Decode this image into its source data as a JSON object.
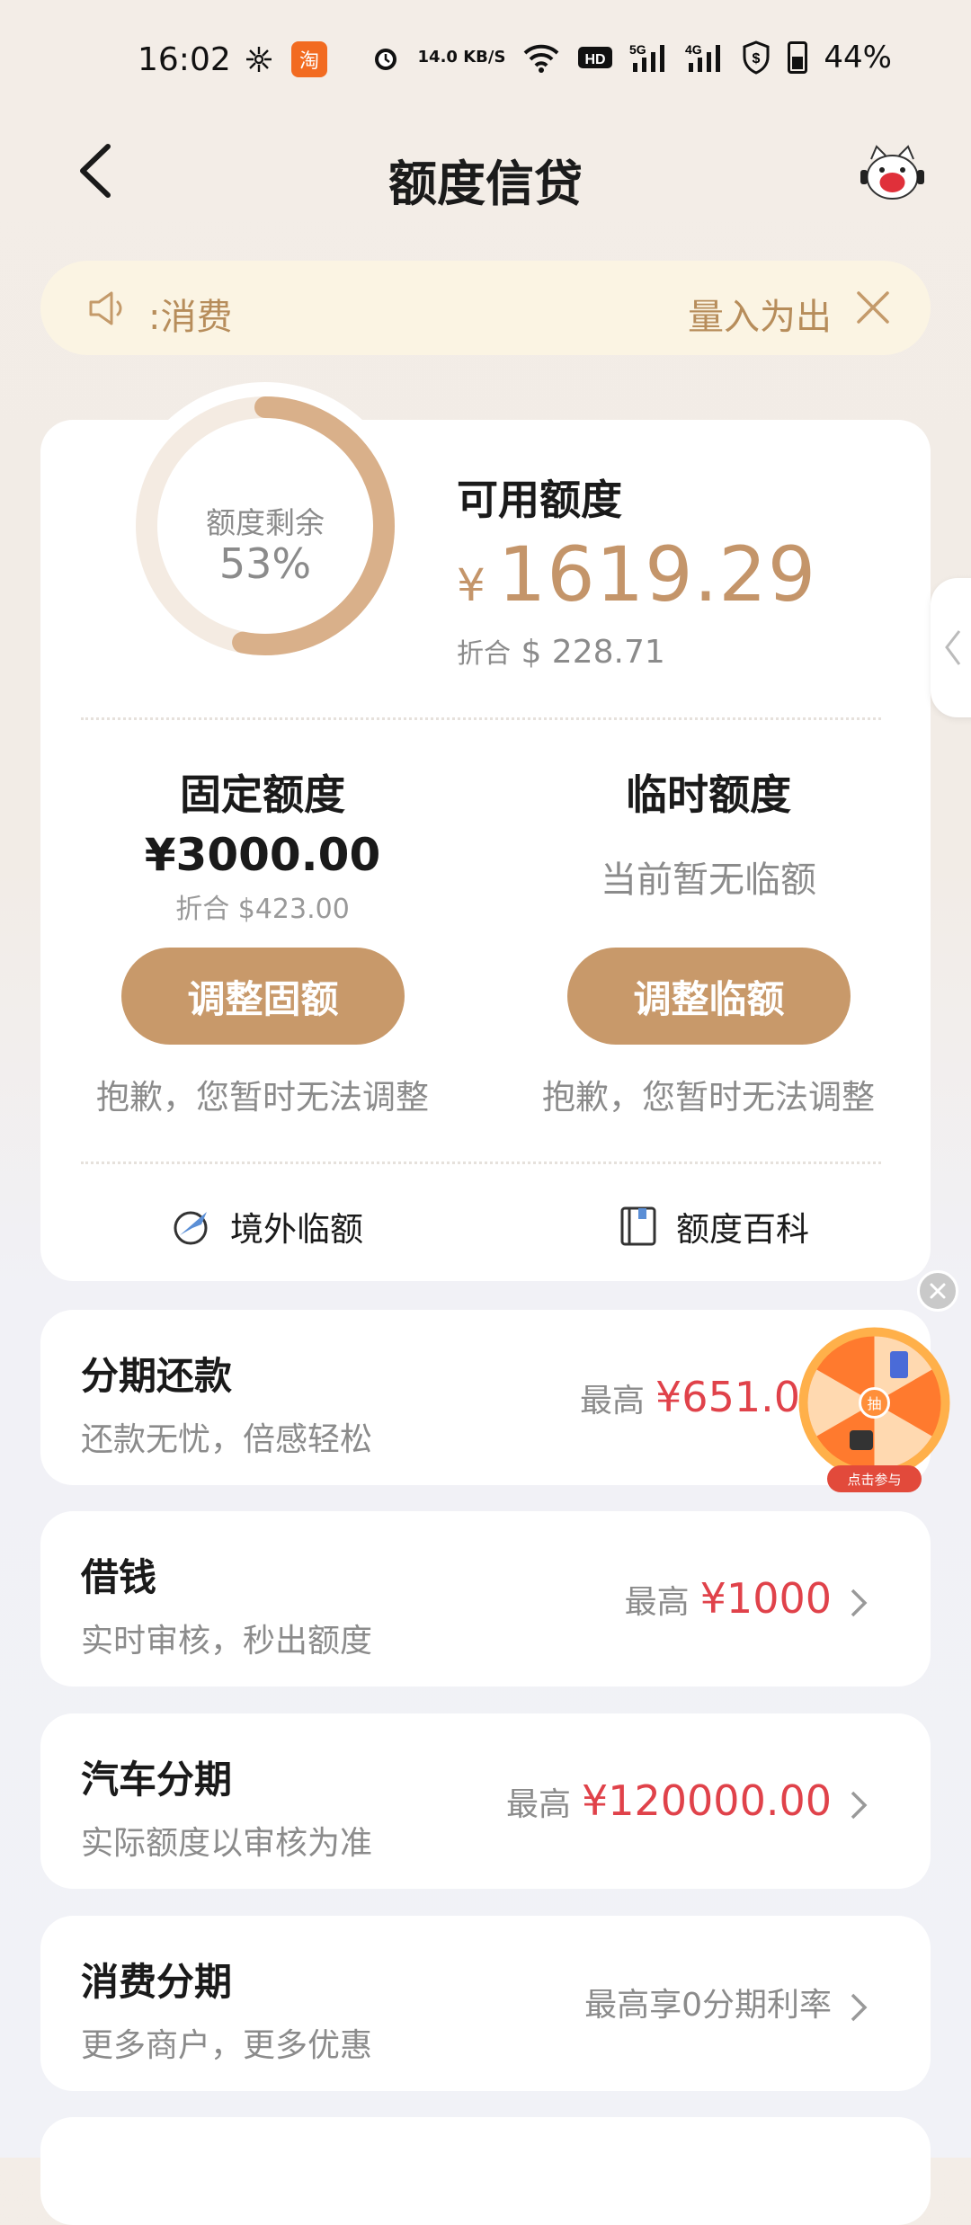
{
  "status_bar": {
    "time": "16:02",
    "net_speed": "14.0 KB/S",
    "battery": "44%"
  },
  "header": {
    "title": "额度信贷"
  },
  "notice": {
    "text": ":消费",
    "right_text": "量入为出"
  },
  "credit": {
    "ring_label": "额度剩余",
    "ring_percent": "53%",
    "ring_fraction": 0.53,
    "available_label": "可用额度",
    "available_currency": "¥",
    "available_amount": "1619.29",
    "available_conv_prefix": "折合",
    "available_conv_value": "$ 228.71"
  },
  "fixed": {
    "title": "固定额度",
    "amount": "¥3000.00",
    "conv": "折合 $423.00",
    "button": "调整固额",
    "note": "抱歉，您暂时无法调整"
  },
  "temp": {
    "title": "临时额度",
    "none_text": "当前暂无临额",
    "button": "调整临额",
    "note": "抱歉，您暂时无法调整"
  },
  "links": {
    "overseas": "境外临额",
    "wiki": "额度百科"
  },
  "services": [
    {
      "title": "分期还款",
      "sub": "还款无忧，倍感轻松",
      "pre": "最高",
      "value": "¥651.0"
    },
    {
      "title": "借钱",
      "sub": "实时审核，秒出额度",
      "pre": "最高",
      "value": "¥1000"
    },
    {
      "title": "汽车分期",
      "sub": "实际额度以审核为准",
      "pre": "最高",
      "value": "¥120000.00"
    },
    {
      "title": "消费分期",
      "sub": "更多商户，更多优惠",
      "rate": "最高享0分期利率"
    }
  ],
  "promo": {
    "center_char": "抽",
    "tag": "点击参与"
  },
  "colors": {
    "accent_gold": "#c8996a",
    "price_red": "#e0424a",
    "notice_bg": "#fbf4e3"
  }
}
